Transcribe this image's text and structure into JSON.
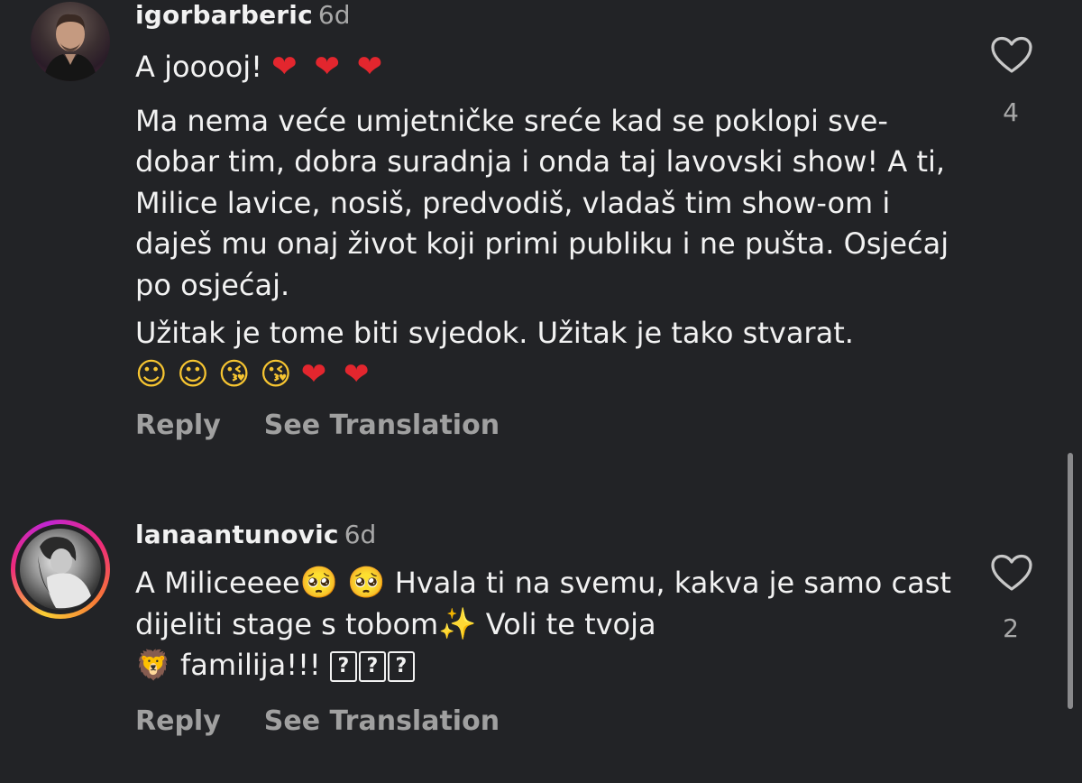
{
  "comments": [
    {
      "username": "igorbarberic",
      "time": "6d",
      "first_line_text": "A jooooj! ",
      "first_line_emoji": "❤ ❤ ❤",
      "paragraph_1": "Ma nema veće umjetničke sreće kad se poklopi sve- dobar tim, dobra suradnja i onda taj lavovski show!  A ti, Milice lavice, nosiš, predvodiš, vladaš tim show-om i daješ mu onaj život koji primi publiku i ne pušta. Osjećaj po osjećaj.",
      "paragraph_2": "Užitak je tome biti svjedok. Užitak je tako stvarat.",
      "paragraph_2_emoji_smiles": "☺ ☺",
      "paragraph_2_emoji_kisses": "😘 😘",
      "paragraph_2_emoji_hearts": "❤ ❤",
      "likes": "4",
      "reply_label": "Reply",
      "translate_label": "See Translation",
      "avatar_icon": "profile-photo-man",
      "like_icon": "heart-outline-icon"
    },
    {
      "username": "lanaantunovic",
      "time": "6d",
      "text_a": "A Miliceeee",
      "emoji_pleading": "🥺",
      "text_b": " Hvala ti na svemu, kakva je samo cast dijeliti stage s tobom",
      "emoji_sparkles": "✨",
      "text_c": " Voli te tvoja ",
      "emoji_lion": "🦁",
      "text_d": " familija!!! ",
      "missing_glyph": "?",
      "likes": "2",
      "reply_label": "Reply",
      "translate_label": "See Translation",
      "avatar_icon": "profile-photo-woman",
      "like_icon": "heart-outline-icon",
      "story_ring_colors": [
        "#f9ce34",
        "#ee2a7b",
        "#c026d3"
      ]
    }
  ],
  "colors": {
    "background": "#222326",
    "text_primary": "#f2f2f2",
    "text_secondary": "#a8a8a8",
    "heart_red": "#e3262e"
  }
}
